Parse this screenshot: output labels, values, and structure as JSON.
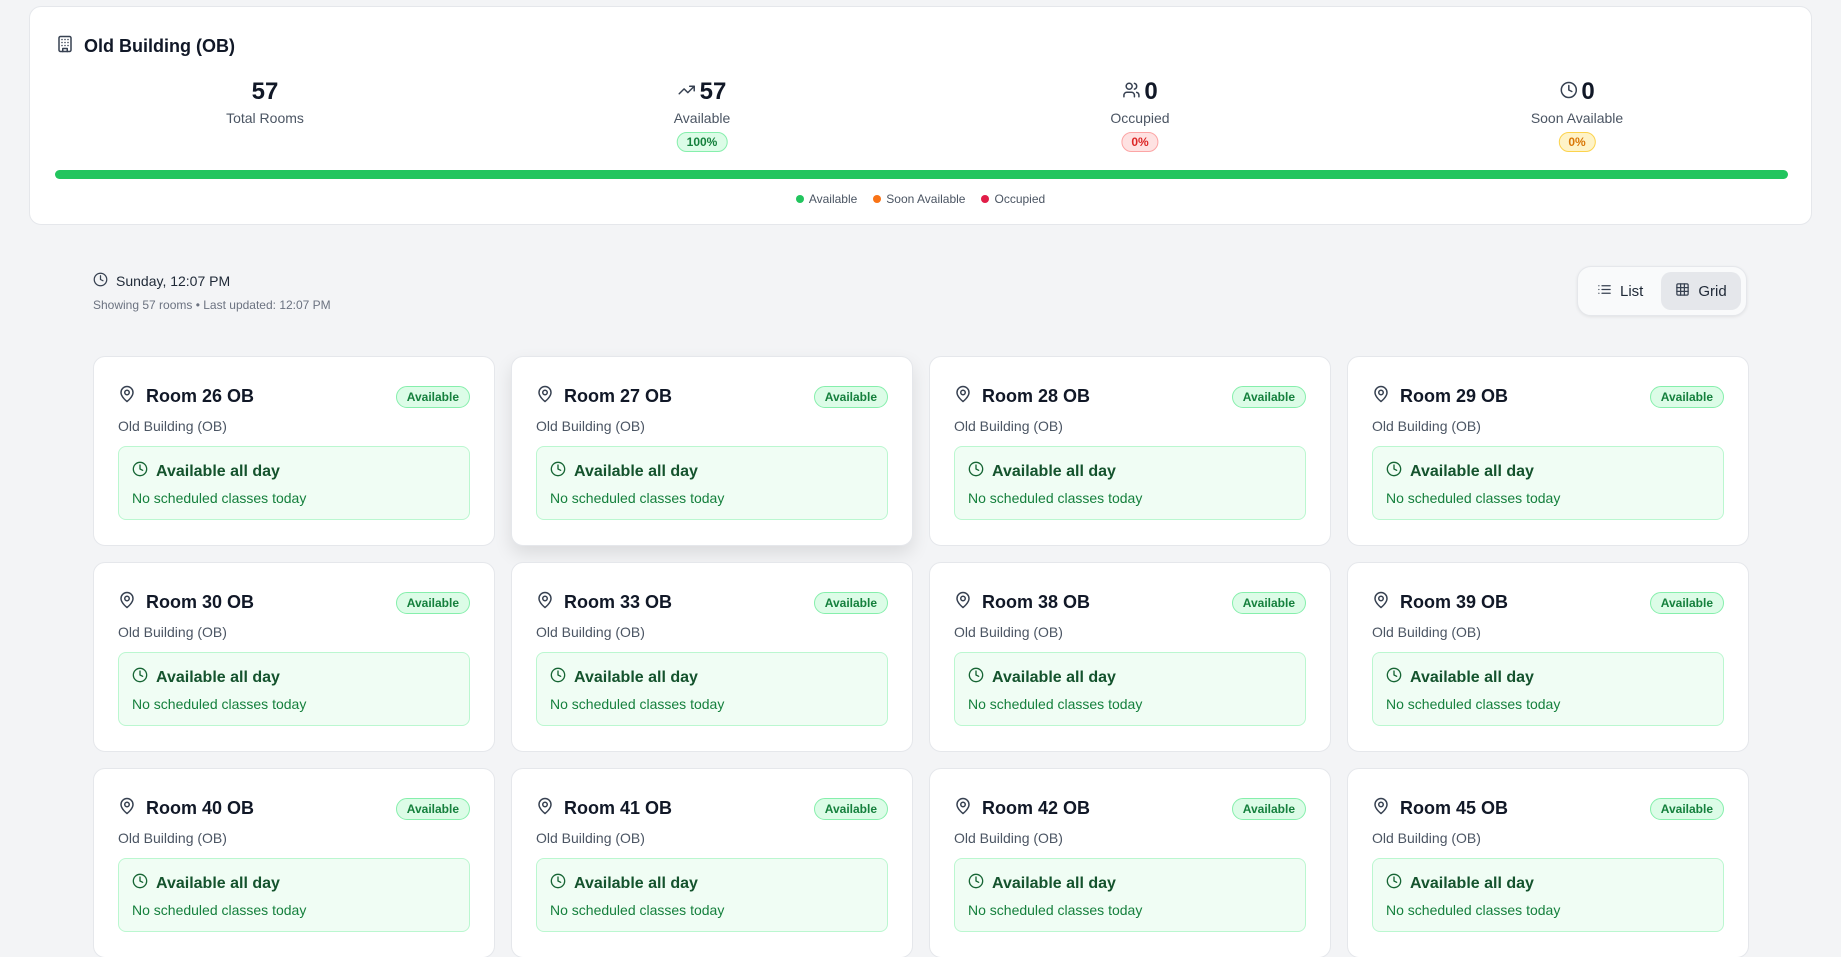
{
  "summary": {
    "building_title": "Old Building (OB)",
    "building_icon": "building-icon",
    "stats": {
      "total": {
        "value": "57",
        "label": "Total Rooms"
      },
      "available": {
        "value": "57",
        "label": "Available",
        "percent": "100%",
        "icon": "trending-up-icon"
      },
      "occupied": {
        "value": "0",
        "label": "Occupied",
        "percent": "0%",
        "icon": "users-icon"
      },
      "soon": {
        "value": "0",
        "label": "Soon Available",
        "percent": "0%",
        "icon": "clock-icon"
      }
    },
    "progress": {
      "available": 1.0,
      "soon": 0.0,
      "occupied": 0.0
    },
    "legend": {
      "available": "Available",
      "soon": "Soon Available",
      "occupied": "Occupied"
    },
    "colors": {
      "available": "#22c55e",
      "soon": "#f97316",
      "occupied": "#e11d48"
    }
  },
  "info": {
    "datetime": "Sunday, 12:07 PM",
    "subtitle": "Showing 57 rooms • Last updated: 12:07 PM"
  },
  "view_toggle": {
    "list_label": "List",
    "grid_label": "Grid",
    "active": "grid"
  },
  "rooms": [
    {
      "name": "Room 26 OB",
      "building": "Old Building (OB)",
      "status": "Available",
      "availability": "Available all day",
      "note": "No scheduled classes today"
    },
    {
      "name": "Room 27 OB",
      "building": "Old Building (OB)",
      "status": "Available",
      "availability": "Available all day",
      "note": "No scheduled classes today"
    },
    {
      "name": "Room 28 OB",
      "building": "Old Building (OB)",
      "status": "Available",
      "availability": "Available all day",
      "note": "No scheduled classes today"
    },
    {
      "name": "Room 29 OB",
      "building": "Old Building (OB)",
      "status": "Available",
      "availability": "Available all day",
      "note": "No scheduled classes today"
    },
    {
      "name": "Room 30 OB",
      "building": "Old Building (OB)",
      "status": "Available",
      "availability": "Available all day",
      "note": "No scheduled classes today"
    },
    {
      "name": "Room 33 OB",
      "building": "Old Building (OB)",
      "status": "Available",
      "availability": "Available all day",
      "note": "No scheduled classes today"
    },
    {
      "name": "Room 38 OB",
      "building": "Old Building (OB)",
      "status": "Available",
      "availability": "Available all day",
      "note": "No scheduled classes today"
    },
    {
      "name": "Room 39 OB",
      "building": "Old Building (OB)",
      "status": "Available",
      "availability": "Available all day",
      "note": "No scheduled classes today"
    },
    {
      "name": "Room 40 OB",
      "building": "Old Building (OB)",
      "status": "Available",
      "availability": "Available all day",
      "note": "No scheduled classes today"
    },
    {
      "name": "Room 41 OB",
      "building": "Old Building (OB)",
      "status": "Available",
      "availability": "Available all day",
      "note": "No scheduled classes today"
    },
    {
      "name": "Room 42 OB",
      "building": "Old Building (OB)",
      "status": "Available",
      "availability": "Available all day",
      "note": "No scheduled classes today"
    },
    {
      "name": "Room 45 OB",
      "building": "Old Building (OB)",
      "status": "Available",
      "availability": "Available all day",
      "note": "No scheduled classes today"
    }
  ]
}
